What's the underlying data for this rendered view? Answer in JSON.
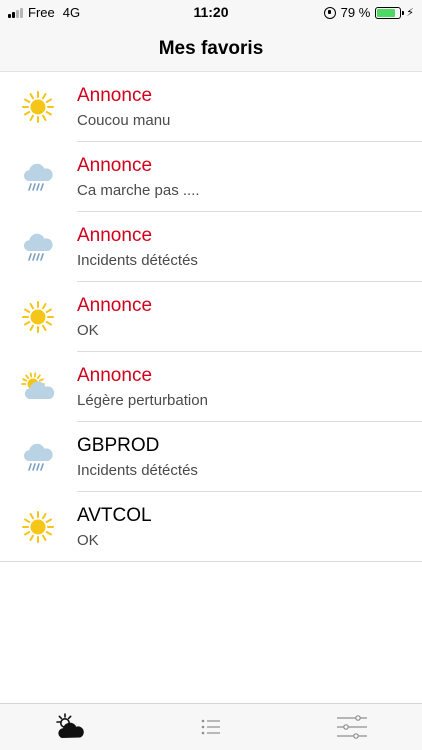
{
  "status_bar": {
    "carrier": "Free",
    "network": "4G",
    "time": "11:20",
    "battery": "79 %",
    "battery_level": 0.79
  },
  "nav": {
    "title": "Mes favoris"
  },
  "list": {
    "items": [
      {
        "title": "Annonce",
        "subtitle": "Coucou manu",
        "weather": "sun-icon",
        "alert": true
      },
      {
        "title": "Annonce",
        "subtitle": "Ca marche pas ....",
        "weather": "rain-cloud-icon",
        "alert": true
      },
      {
        "title": "Annonce",
        "subtitle": "Incidents détéctés",
        "weather": "rain-cloud-icon",
        "alert": true
      },
      {
        "title": "Annonce",
        "subtitle": "OK",
        "weather": "sun-icon",
        "alert": true
      },
      {
        "title": "Annonce",
        "subtitle": "Légère perturbation",
        "weather": "partly-cloudy-icon",
        "alert": true
      },
      {
        "title": "GBPROD",
        "subtitle": "Incidents détéctés",
        "weather": "rain-cloud-icon",
        "alert": false
      },
      {
        "title": "AVTCOL",
        "subtitle": "OK",
        "weather": "sun-icon",
        "alert": false
      }
    ]
  },
  "tab_bar": {
    "tabs": [
      {
        "icon": "weather-tab-icon",
        "selected": true
      },
      {
        "icon": "list-tab-icon",
        "selected": false
      },
      {
        "icon": "settings-sliders-icon",
        "selected": false
      }
    ]
  },
  "colors": {
    "alert_title": "#d0021b",
    "sun": "#f5c518",
    "cloud": "#b9d3e4",
    "rain": "#7aa2c0",
    "battery": "#4cd964"
  }
}
